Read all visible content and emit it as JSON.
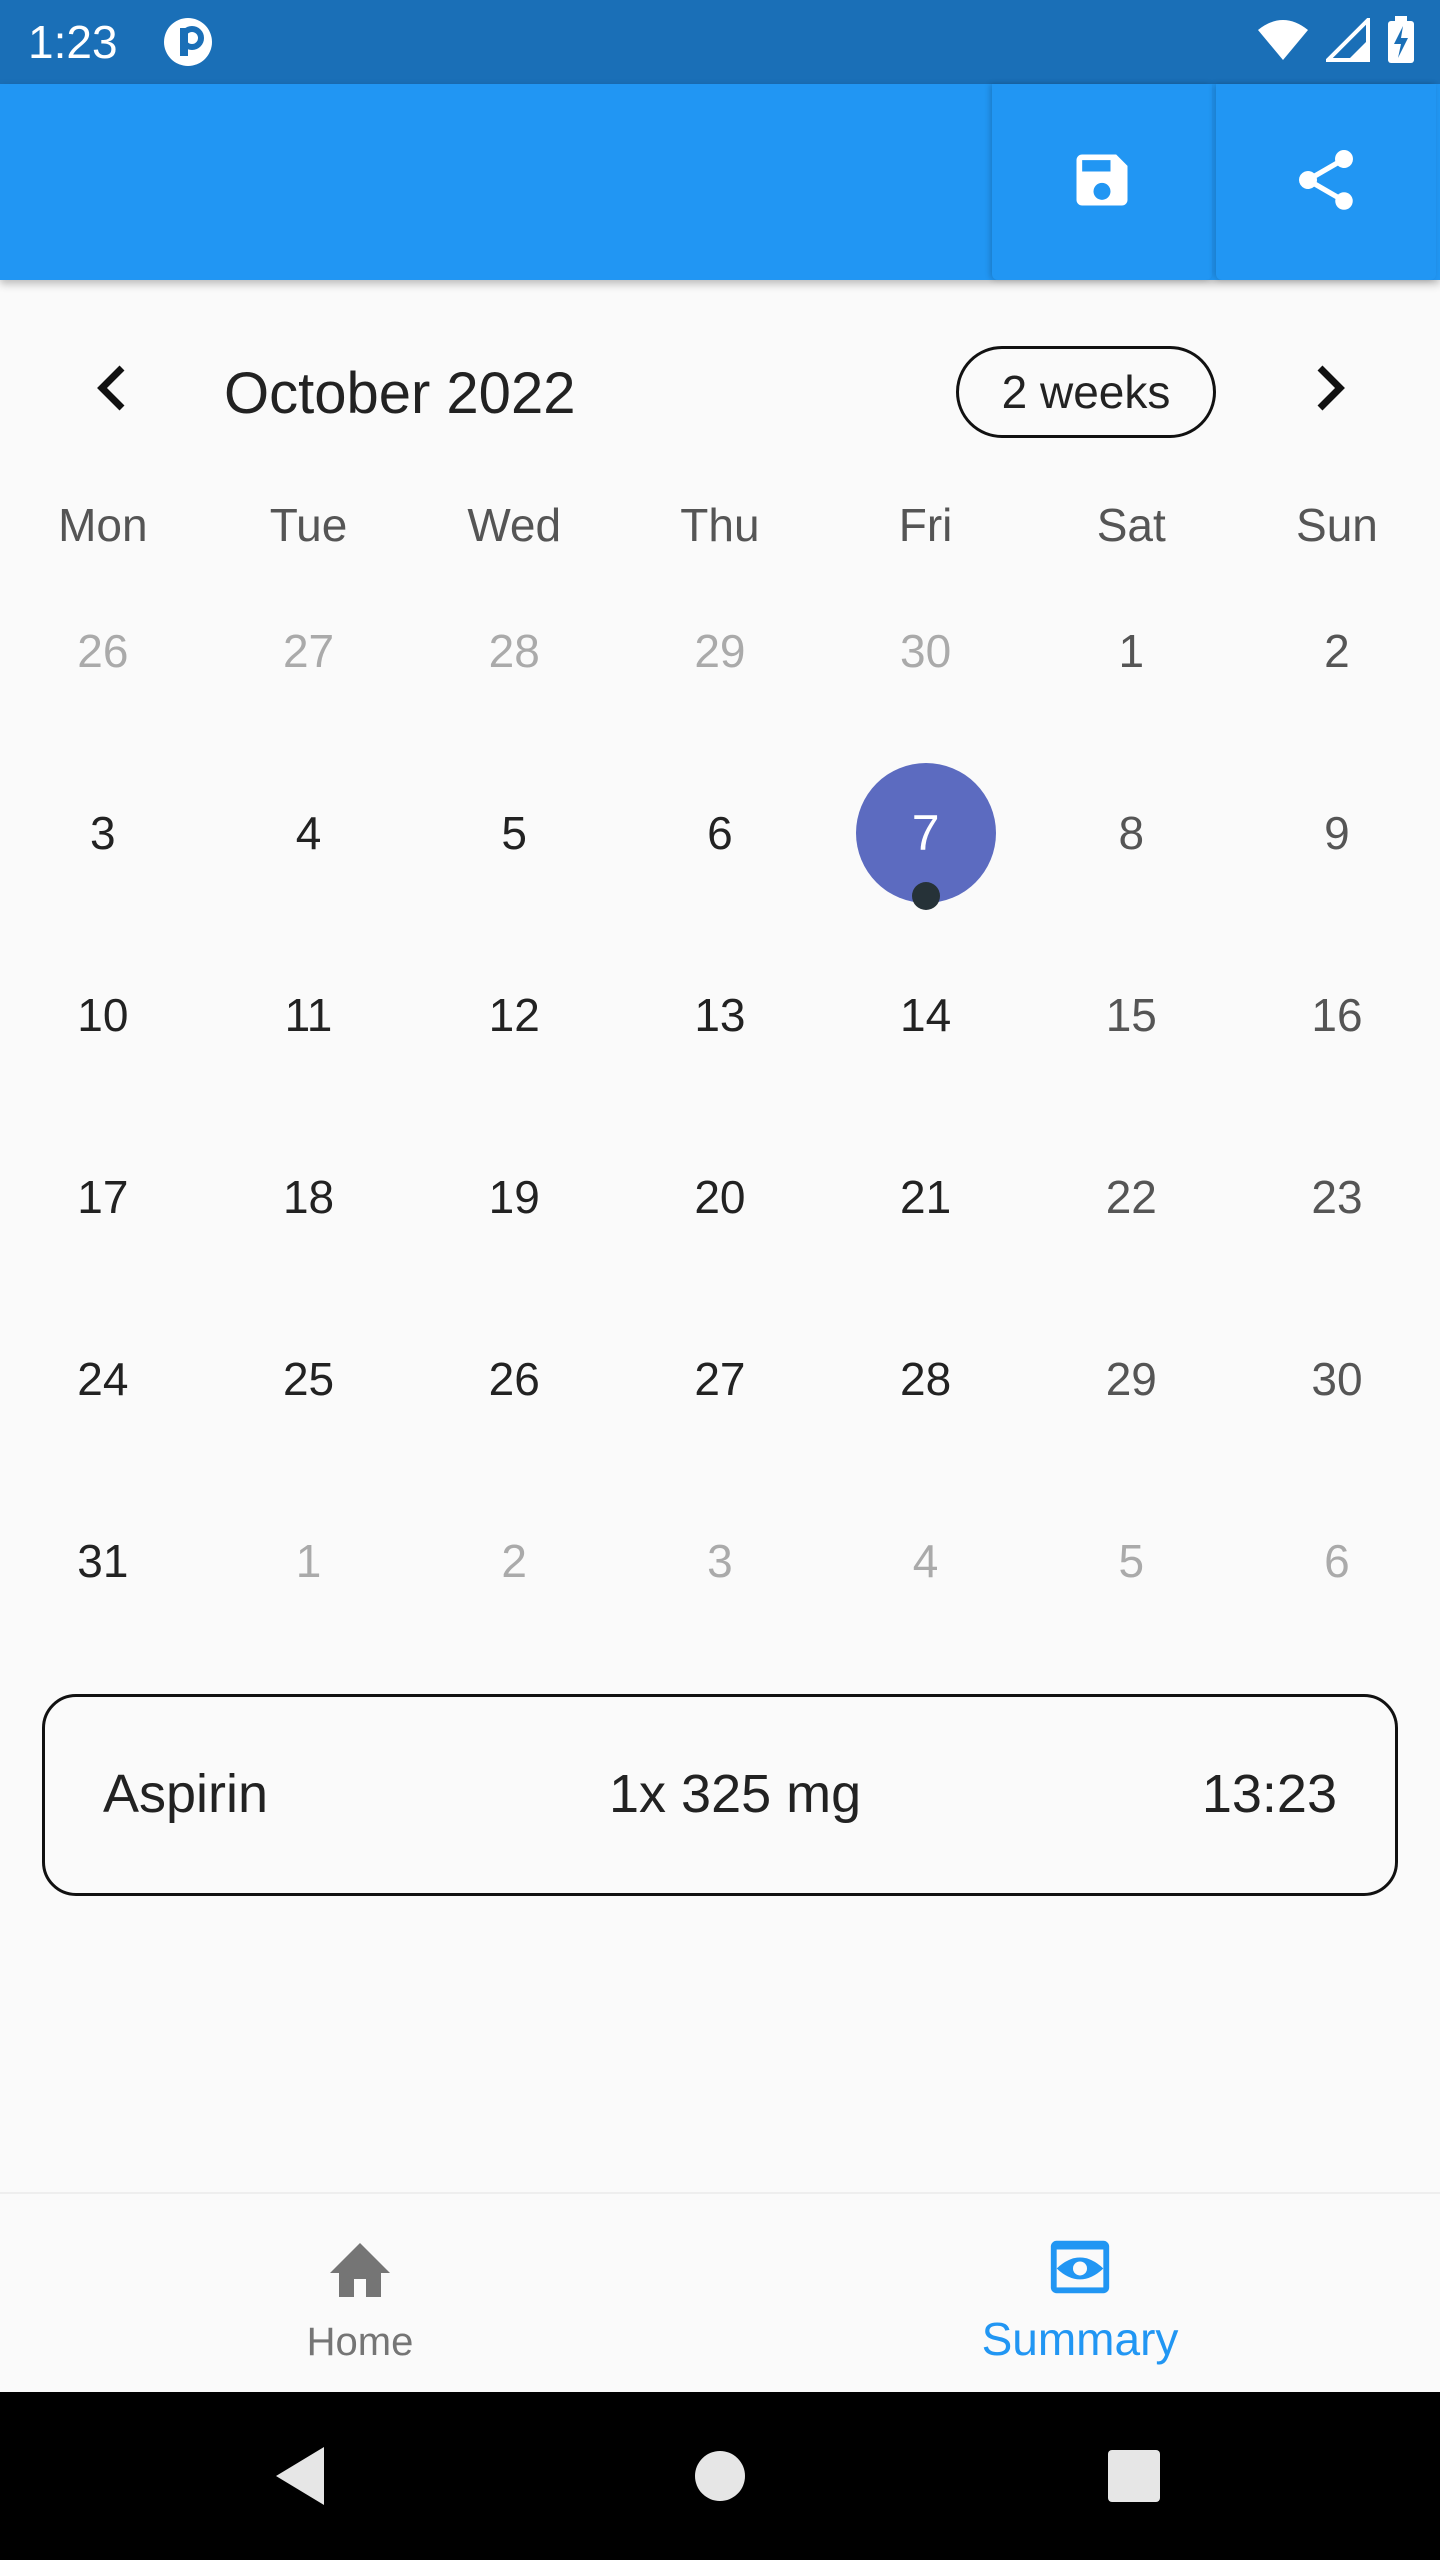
{
  "status_bar": {
    "time": "1:23",
    "icons": [
      "app-notification-icon",
      "wifi-icon",
      "signal-icon",
      "battery-charging-icon"
    ]
  },
  "app_bar": {
    "actions": [
      {
        "icon": "save-icon"
      },
      {
        "icon": "share-icon"
      }
    ],
    "color": "#2196f3"
  },
  "calendar": {
    "month_title": "October 2022",
    "format_button": "2 weeks",
    "weekdays": [
      "Mon",
      "Tue",
      "Wed",
      "Thu",
      "Fri",
      "Sat",
      "Sun"
    ],
    "weeks": [
      [
        {
          "d": "26",
          "out": true
        },
        {
          "d": "27",
          "out": true
        },
        {
          "d": "28",
          "out": true
        },
        {
          "d": "29",
          "out": true
        },
        {
          "d": "30",
          "out": true
        },
        {
          "d": "1"
        },
        {
          "d": "2"
        }
      ],
      [
        {
          "d": "3"
        },
        {
          "d": "4"
        },
        {
          "d": "5"
        },
        {
          "d": "6"
        },
        {
          "d": "7",
          "selected": true,
          "event": true
        },
        {
          "d": "8"
        },
        {
          "d": "9"
        }
      ],
      [
        {
          "d": "10"
        },
        {
          "d": "11"
        },
        {
          "d": "12"
        },
        {
          "d": "13"
        },
        {
          "d": "14"
        },
        {
          "d": "15"
        },
        {
          "d": "16"
        }
      ],
      [
        {
          "d": "17"
        },
        {
          "d": "18"
        },
        {
          "d": "19"
        },
        {
          "d": "20"
        },
        {
          "d": "21"
        },
        {
          "d": "22"
        },
        {
          "d": "23"
        }
      ],
      [
        {
          "d": "24"
        },
        {
          "d": "25"
        },
        {
          "d": "26"
        },
        {
          "d": "27"
        },
        {
          "d": "28"
        },
        {
          "d": "29"
        },
        {
          "d": "30"
        }
      ],
      [
        {
          "d": "31"
        },
        {
          "d": "1",
          "out": true
        },
        {
          "d": "2",
          "out": true
        },
        {
          "d": "3",
          "out": true
        },
        {
          "d": "4",
          "out": true
        },
        {
          "d": "5",
          "out": true
        },
        {
          "d": "6",
          "out": true
        }
      ]
    ],
    "selected_color": "#5c6bc0"
  },
  "event": {
    "name": "Aspirin",
    "dose": "1x 325 mg",
    "time": "13:23"
  },
  "bottom_nav": {
    "items": [
      {
        "label": "Home",
        "icon": "home-icon",
        "active": false
      },
      {
        "label": "Summary",
        "icon": "summary-eye-icon",
        "active": true
      }
    ],
    "active_color": "#2196f3",
    "inactive_color": "#757575"
  },
  "system_nav": {
    "buttons": [
      "back-icon",
      "home-circle-icon",
      "recents-icon"
    ]
  }
}
